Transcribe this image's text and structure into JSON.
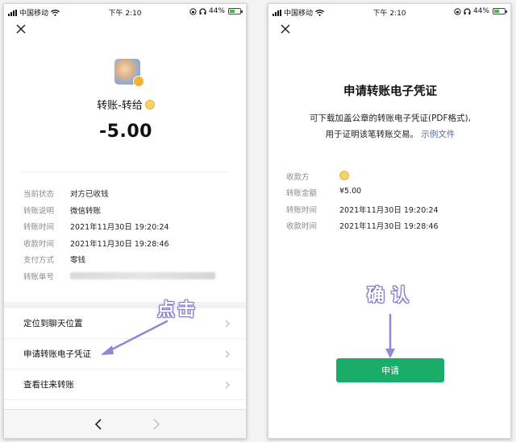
{
  "status_bar": {
    "carrier": "中国移动",
    "time": "下午 2:10",
    "battery": "44%"
  },
  "left": {
    "title": "转账-转给",
    "amount": "-5.00",
    "details": [
      {
        "label": "当前状态",
        "value": "对方已收钱"
      },
      {
        "label": "转账说明",
        "value": "微信转账"
      },
      {
        "label": "转账时间",
        "value": "2021年11月30日 19:20:24"
      },
      {
        "label": "收款时间",
        "value": "2021年11月30日 19:28:46"
      },
      {
        "label": "支付方式",
        "value": "零钱"
      },
      {
        "label": "转账单号",
        "value": ""
      }
    ],
    "menu": [
      {
        "label": "定位到聊天位置"
      },
      {
        "label": "申请转账电子凭证"
      },
      {
        "label": "查看往来转账"
      }
    ],
    "annotation": "点击"
  },
  "right": {
    "title": "申请转账电子凭证",
    "desc_line1": "可下载加盖公章的转账电子凭证(PDF格式),",
    "desc_line2": "用于证明该笔转账交易。",
    "sample_link": "示例文件",
    "details": [
      {
        "label": "收款方",
        "value": ""
      },
      {
        "label": "转账金额",
        "value": "¥5.00"
      },
      {
        "label": "转账时间",
        "value": "2021年11月30日 19:20:24"
      },
      {
        "label": "收款时间",
        "value": "2021年11月30日 19:28:46"
      }
    ],
    "annotation": "确认",
    "apply_button": "申请"
  },
  "colors": {
    "accent_green": "#1aad6a",
    "link_blue": "#576b95",
    "annotation_purple": "#7b74c9"
  },
  "icons": [
    "close-icon",
    "chevron-right-icon",
    "back-arrow-icon",
    "forward-arrow-icon",
    "wifi-icon",
    "signal-icon",
    "battery-icon",
    "lock-rotation-icon",
    "headphones-icon"
  ]
}
